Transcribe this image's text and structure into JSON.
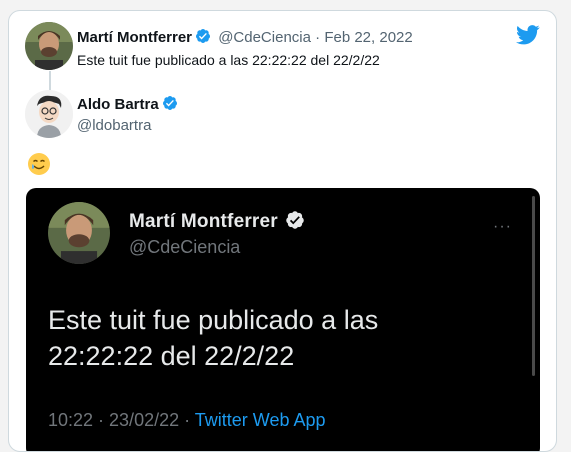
{
  "tweet": {
    "author_name": "Martí Montferrer",
    "handle": "@CdeCiencia",
    "separator": "·",
    "date": "Feb 22, 2022",
    "text": "Este tuit fue publicado a las 22:22:22 del 22/2/22"
  },
  "reply": {
    "name": "Aldo Bartra",
    "handle": "@ldobartra",
    "emoji": "🥲"
  },
  "embedded_screenshot": {
    "name": "Martí Montferrer",
    "handle": "@CdeCiencia",
    "text_line1": "Este tuit fue publicado a las",
    "text_line2": "22:22:22 del 22/2/22",
    "time": "10:22 · 23/02/22 ·",
    "client": "Twitter Web App",
    "more": "···"
  },
  "colors": {
    "twitter_blue": "#1d9bf0",
    "verified_blue": "#1d9bf0",
    "dark_bg": "#000000"
  },
  "icons": [
    "twitter-logo-icon",
    "verified-badge-icon",
    "more-options-icon"
  ]
}
